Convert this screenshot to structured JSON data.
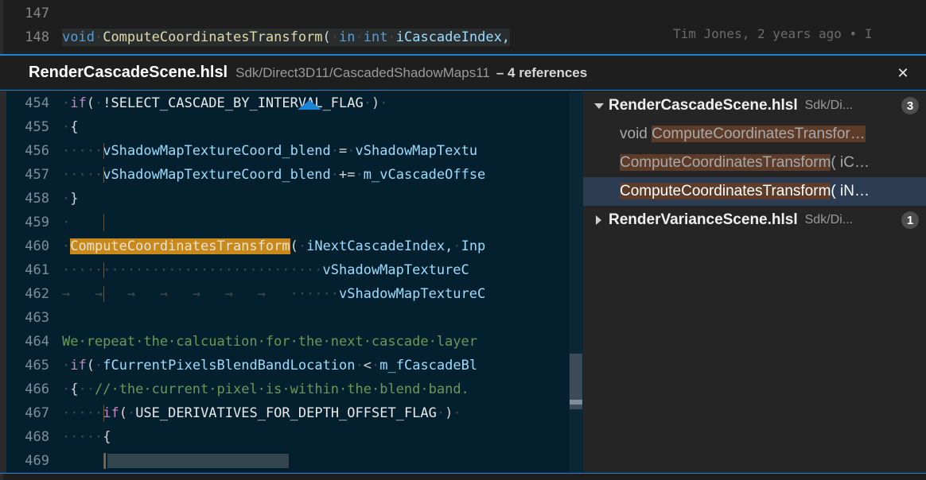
{
  "host_editor": {
    "lines": [
      {
        "number": "147",
        "tokens": []
      },
      {
        "number": "148",
        "tokens": [
          {
            "text": "void",
            "cls": "t-key"
          },
          {
            "text": "·",
            "cls": "t-ws"
          },
          {
            "text": "ComputeCoordinatesTransform",
            "cls": "t-fn"
          },
          {
            "text": "(",
            "cls": "t-punct"
          },
          {
            "text": "·",
            "cls": "t-ws"
          },
          {
            "text": "in",
            "cls": "t-key"
          },
          {
            "text": "·",
            "cls": "t-ws"
          },
          {
            "text": "int",
            "cls": "t-key"
          },
          {
            "text": "·",
            "cls": "t-ws"
          },
          {
            "text": "iCascadeIndex,",
            "cls": "t-var"
          }
        ]
      }
    ],
    "blame": "Tim Jones, 2 years ago • I"
  },
  "peek": {
    "filename": "RenderCascadeScene.hlsl",
    "path": "Sdk/Direct3D11/CascadedShadowMaps11",
    "reference_count_label": "– 4 references",
    "close_label": "✕"
  },
  "preview": {
    "lines": [
      {
        "number": "454",
        "guides": [],
        "tokens": [
          {
            "text": "·",
            "cls": "t-ws"
          },
          {
            "text": "if",
            "cls": "t-macro"
          },
          {
            "text": "(",
            "cls": "t-punct"
          },
          {
            "text": "·",
            "cls": "t-ws"
          },
          {
            "text": "!SELECT_CASCADE_BY_INTERVAL_FLAG",
            "cls": "t-const"
          },
          {
            "text": "·",
            "cls": "t-ws"
          },
          {
            "text": ")",
            "cls": "t-punct"
          },
          {
            "text": "·",
            "cls": "t-ws"
          }
        ]
      },
      {
        "number": "455",
        "guides": [],
        "tokens": [
          {
            "text": "·",
            "cls": "t-ws"
          },
          {
            "text": "{",
            "cls": "t-plain"
          }
        ]
      },
      {
        "number": "456",
        "guides": [
          52
        ],
        "tokens": [
          {
            "text": "·",
            "cls": "t-ws"
          },
          {
            "text": "····",
            "cls": "t-ws"
          },
          {
            "text": "vShadowMapTextureCoord_blend",
            "cls": "t-var"
          },
          {
            "text": "·",
            "cls": "t-ws"
          },
          {
            "text": "=",
            "cls": "t-plain"
          },
          {
            "text": "·",
            "cls": "t-ws"
          },
          {
            "text": "vShadowMapTextu",
            "cls": "t-var"
          }
        ]
      },
      {
        "number": "457",
        "guides": [
          52
        ],
        "tokens": [
          {
            "text": "·",
            "cls": "t-ws"
          },
          {
            "text": "····",
            "cls": "t-ws"
          },
          {
            "text": "vShadowMapTextureCoord_blend",
            "cls": "t-var"
          },
          {
            "text": "·",
            "cls": "t-ws"
          },
          {
            "text": "+=",
            "cls": "t-plain"
          },
          {
            "text": "·",
            "cls": "t-ws"
          },
          {
            "text": "m_vCascadeOffse",
            "cls": "t-var"
          }
        ]
      },
      {
        "number": "458",
        "guides": [],
        "tokens": [
          {
            "text": "·",
            "cls": "t-ws"
          },
          {
            "text": "}",
            "cls": "t-plain"
          }
        ]
      },
      {
        "number": "459",
        "guides": [
          52
        ],
        "tokens": [
          {
            "text": "·",
            "cls": "t-ws"
          }
        ]
      },
      {
        "number": "460",
        "guides": [],
        "match": "ComputeCoordinatesTransform",
        "tokens": [
          {
            "text": "·",
            "cls": "t-ws"
          },
          {
            "text": "ComputeCoordinatesTransform",
            "cls": "hl-match"
          },
          {
            "text": "(",
            "cls": "t-punct"
          },
          {
            "text": "·",
            "cls": "t-ws"
          },
          {
            "text": "iNextCascadeIndex,",
            "cls": "t-var"
          },
          {
            "text": "·",
            "cls": "t-ws"
          },
          {
            "text": "Inp",
            "cls": "t-var"
          }
        ]
      },
      {
        "number": "461",
        "guides": [
          52
        ],
        "tokens": [
          {
            "text": "·",
            "cls": "t-ws"
          },
          {
            "text": "·······························",
            "cls": "t-ws"
          },
          {
            "text": "vShadowMapTextureC",
            "cls": "t-var"
          }
        ]
      },
      {
        "number": "462",
        "guides": [
          52
        ],
        "tokens": [
          {
            "text": "→   →   →   →   →   →   →   ",
            "cls": "t-ws"
          },
          {
            "text": "······",
            "cls": "t-ws"
          },
          {
            "text": "vShadowMapTextureC",
            "cls": "t-var"
          }
        ]
      },
      {
        "number": "463",
        "guides": [
          52
        ],
        "tokens": []
      },
      {
        "number": "464",
        "guides": [],
        "tokens": [
          {
            "text": "We·repeat·the·calcuation·for·the·next·cascade·layer",
            "cls": "t-comment"
          }
        ]
      },
      {
        "number": "465",
        "guides": [],
        "tokens": [
          {
            "text": "·",
            "cls": "t-ws"
          },
          {
            "text": "if",
            "cls": "t-macro"
          },
          {
            "text": "(",
            "cls": "t-punct"
          },
          {
            "text": "·",
            "cls": "t-ws"
          },
          {
            "text": "fCurrentPixelsBlendBandLocation",
            "cls": "t-var"
          },
          {
            "text": "·",
            "cls": "t-ws"
          },
          {
            "text": "<",
            "cls": "t-plain"
          },
          {
            "text": "·",
            "cls": "t-ws"
          },
          {
            "text": "m_fCascadeBl",
            "cls": "t-var"
          }
        ]
      },
      {
        "number": "466",
        "guides": [],
        "tokens": [
          {
            "text": "·",
            "cls": "t-ws"
          },
          {
            "text": "{",
            "cls": "t-plain"
          },
          {
            "text": "··",
            "cls": "t-ws"
          },
          {
            "text": "//·the·current·pixel·is·within·the·blend·band.",
            "cls": "t-comment"
          }
        ]
      },
      {
        "number": "467",
        "guides": [
          52
        ],
        "tokens": [
          {
            "text": "·",
            "cls": "t-ws"
          },
          {
            "text": "····",
            "cls": "t-ws"
          },
          {
            "text": "if",
            "cls": "t-macro"
          },
          {
            "text": "(",
            "cls": "t-punct"
          },
          {
            "text": "·",
            "cls": "t-ws"
          },
          {
            "text": "USE_DERIVATIVES_FOR_DEPTH_OFFSET_FLAG",
            "cls": "t-const"
          },
          {
            "text": "·",
            "cls": "t-ws"
          },
          {
            "text": ")",
            "cls": "t-punct"
          },
          {
            "text": "·",
            "cls": "t-ws"
          }
        ]
      },
      {
        "number": "468",
        "guides": [],
        "tokens": [
          {
            "text": "·····",
            "cls": "t-ws"
          },
          {
            "text": "{",
            "cls": "t-plain"
          }
        ]
      },
      {
        "number": "469",
        "guides": [
          52
        ],
        "placeholder": true,
        "tokens": []
      }
    ]
  },
  "tree": {
    "rows": [
      {
        "kind": "file",
        "twisty": "open",
        "filename": "RenderCascadeScene.hlsl",
        "path": "Sdk/Di...",
        "badge": "3",
        "selected": false
      },
      {
        "kind": "ref",
        "prefix": "void ",
        "highlight": "ComputeCoordinatesTransfor…",
        "suffix": "",
        "selected": false
      },
      {
        "kind": "ref",
        "prefix": "",
        "highlight": "ComputeCoordinatesTransform",
        "suffix": "( iC…",
        "selected": false
      },
      {
        "kind": "ref",
        "prefix": "",
        "highlight": "ComputeCoordinatesTransform",
        "suffix": "( iN…",
        "selected": true
      },
      {
        "kind": "file",
        "twisty": "closed",
        "filename": "RenderVarianceScene.hlsl",
        "path": "Sdk/Di...",
        "badge": "1",
        "selected": false
      }
    ]
  }
}
